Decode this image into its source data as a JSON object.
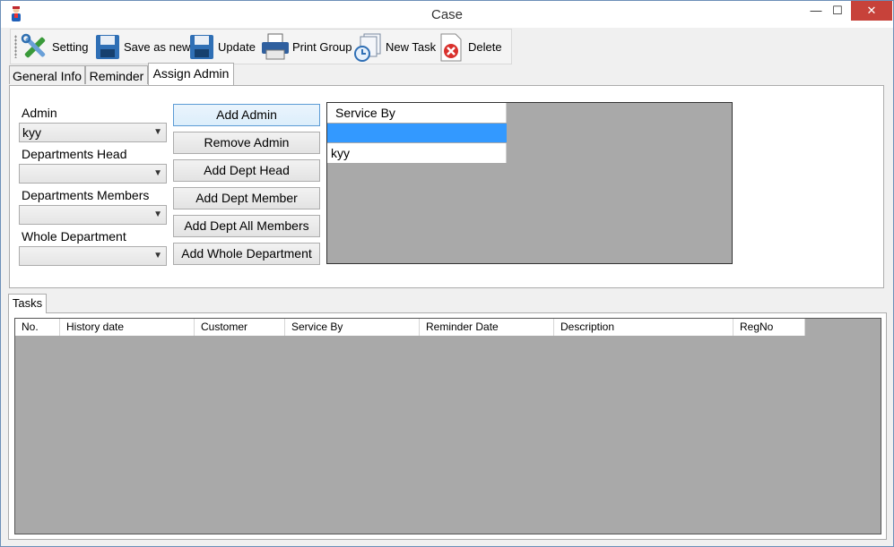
{
  "window": {
    "title": "Case",
    "minimize": "—",
    "maximize": "☐",
    "close": "✕"
  },
  "toolbar": {
    "setting": "Setting",
    "save_as_new": "Save as new",
    "update": "Update",
    "print_group": "Print Group",
    "new_task": "New Task",
    "delete": "Delete"
  },
  "tabs": [
    "General Info",
    "Reminder",
    "Assign Admin"
  ],
  "assign": {
    "admin_label": "Admin",
    "admin_value": "kyy",
    "dept_head_label": "Departments Head",
    "dept_head_value": "",
    "dept_members_label": "Departments Members",
    "dept_members_value": "",
    "whole_dept_label": "Whole Department",
    "whole_dept_value": "",
    "buttons": [
      "Add Admin",
      "Remove Admin",
      "Add Dept Head",
      "Add Dept Member",
      "Add Dept All Members",
      "Add Whole Department"
    ]
  },
  "service_grid": {
    "header": "Service By",
    "rows": [
      "",
      "kyy"
    ]
  },
  "tasks": {
    "tab_label": "Tasks",
    "columns": [
      "No.",
      "History date",
      "Customer",
      "Service By",
      "Reminder Date",
      "Description",
      "RegNo"
    ]
  },
  "colors": {
    "selection": "#3399ff",
    "grid_bg": "#a9a9a9",
    "close_btn": "#c7423a"
  }
}
